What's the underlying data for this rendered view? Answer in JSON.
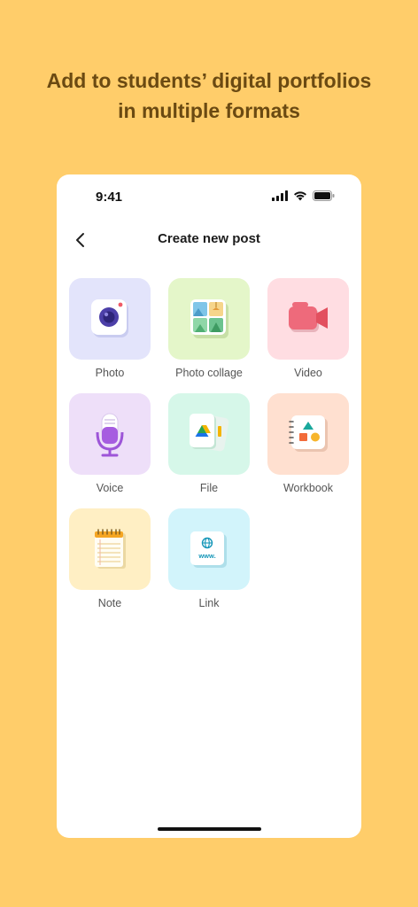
{
  "headline": {
    "line1": "Add to students’ digital portfolios",
    "line2": "in multiple formats"
  },
  "status_bar": {
    "time": "9:41"
  },
  "header": {
    "title": "Create new post"
  },
  "post_types": [
    {
      "label": "Photo",
      "icon": "camera-icon",
      "color": "#E3E4FB"
    },
    {
      "label": "Photo collage",
      "icon": "photo-collage-icon",
      "color": "#E4F6C9"
    },
    {
      "label": "Video",
      "icon": "video-camera-icon",
      "color": "#FFDDE2"
    },
    {
      "label": "Voice",
      "icon": "microphone-icon",
      "color": "#EEDFF9"
    },
    {
      "label": "File",
      "icon": "file-icon",
      "color": "#D6F7E9"
    },
    {
      "label": "Workbook",
      "icon": "workbook-icon",
      "color": "#FFE0D0"
    },
    {
      "label": "Note",
      "icon": "notepad-icon",
      "color": "#FFEFC4"
    },
    {
      "label": "Link",
      "icon": "link-globe-icon",
      "color": "#D2F4FB",
      "icon_text": "www."
    }
  ]
}
